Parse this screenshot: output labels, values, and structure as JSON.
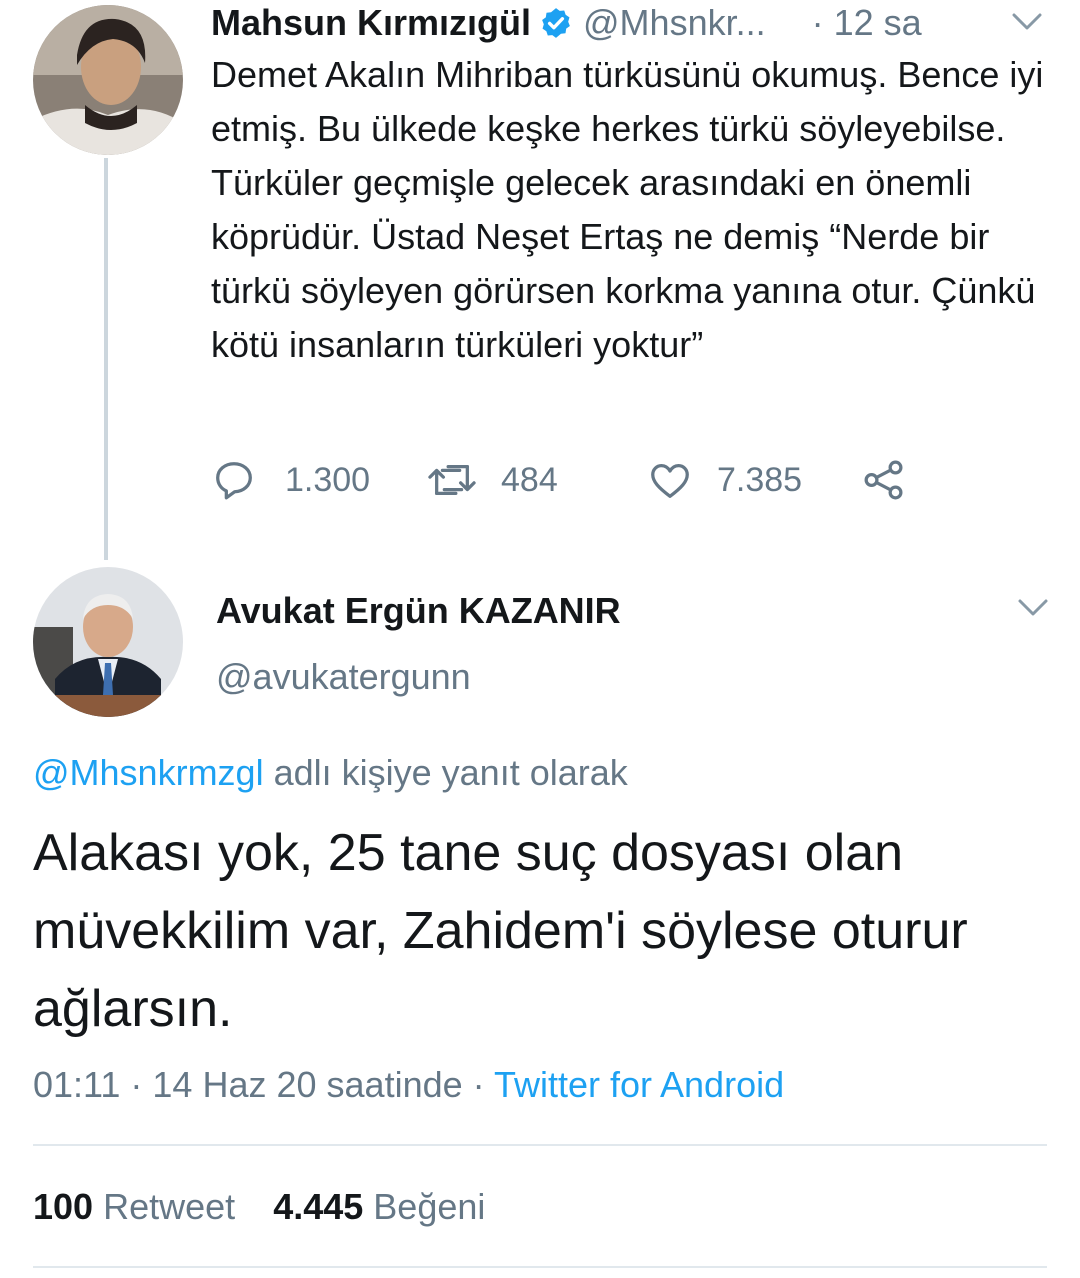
{
  "parent_tweet": {
    "author_name": "Mahsun Kırmızıgül",
    "handle": "@Mhsnkr...",
    "separator": "·",
    "time": "12 sa",
    "text": "Demet Akalın Mihriban türküsünü okumuş. Bence iyi etmiş. Bu ülkede keşke herkes türkü söyleyebilse.  Türküler geçmişle gelecek arasındaki en önemli köprüdür. Üstad Neşet Ertaş ne demiş  “Nerde bir türkü söyleyen görürsen korkma yanına otur. Çünkü kötü insanların türküleri yoktur”",
    "replies": "1.300",
    "retweets": "484",
    "likes": "7.385",
    "icons": [
      "verified-badge-icon",
      "chevron-down-icon",
      "reply-icon",
      "retweet-icon",
      "like-icon",
      "share-icon"
    ],
    "avatar_icon": "avatar-photo"
  },
  "main_tweet": {
    "author_name": "Avukat Ergün KAZANIR",
    "handle": "@avukatergunn",
    "reply_to_handle": "@Mhsnkrmzgl",
    "reply_to_suffix": "adlı kişiye yanıt olarak",
    "text": "Alakası yok, 25 tane suç dosyası olan müvekkilim var, Zahidem'i söylese oturur ağlarsın.",
    "timestamp": "01:11 · 14 Haz 20 saatinde ·",
    "source": "Twitter for Android",
    "retweet_count": "100",
    "retweet_label": "Retweet",
    "like_count": "4.445",
    "like_label": "Beğeni",
    "avatar_icon": "avatar-photo"
  },
  "colors": {
    "text": "#14171a",
    "muted": "#657786",
    "link": "#1da1f2",
    "divider": "#e1e8ed",
    "thread_line": "#ccd6dd"
  }
}
